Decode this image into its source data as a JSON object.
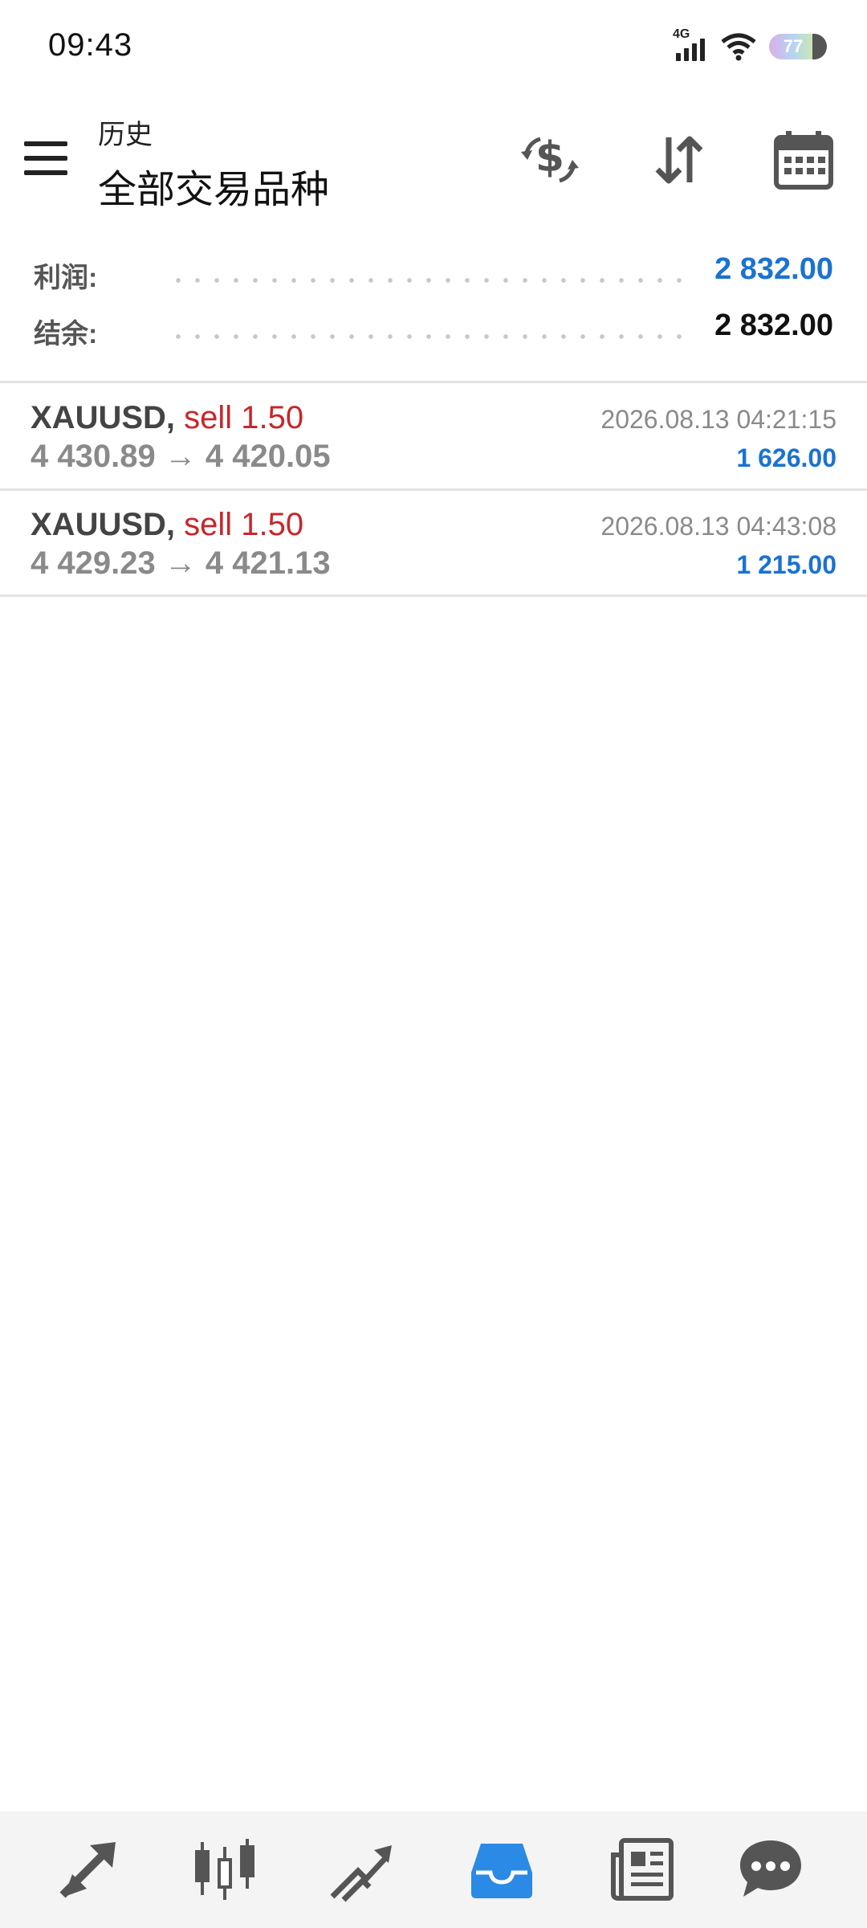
{
  "status_bar": {
    "time": "09:43",
    "network": "4G",
    "battery": "77",
    "icons": [
      "signal-icon",
      "wifi-icon",
      "battery-icon"
    ]
  },
  "header": {
    "subtitle": "历史",
    "title": "全部交易品种",
    "actions": [
      "currency-exchange-icon",
      "sort-icon",
      "calendar-icon"
    ]
  },
  "summary": {
    "profit_label": "利润:",
    "profit_value": "2 832.00",
    "balance_label": "结余:",
    "balance_value": "2 832.00"
  },
  "deals": [
    {
      "symbol": "XAUUSD,",
      "side": "sell 1.50",
      "prices": "4 430.89 → 4 420.05",
      "time": "2026.08.13 04:21:15",
      "profit": "1 626.00"
    },
    {
      "symbol": "XAUUSD,",
      "side": "sell 1.50",
      "prices": "4 429.23 → 4 421.13",
      "time": "2026.08.13 04:43:08",
      "profit": "1 215.00"
    }
  ],
  "bottom_nav": {
    "items": [
      "quotes-icon",
      "chart-icon",
      "trade-icon",
      "history-icon",
      "news-icon",
      "messages-icon"
    ],
    "active": "history-icon"
  },
  "colors": {
    "accent": "#1a73d0",
    "sell": "#c8262b",
    "muted": "#8a8a8a",
    "icon": "#555555"
  }
}
